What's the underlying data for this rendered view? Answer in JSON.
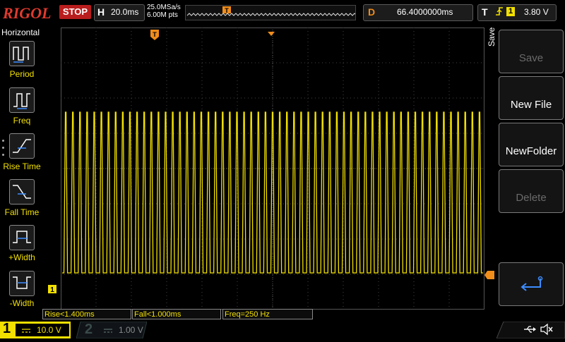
{
  "header": {
    "brand": "RIGOL",
    "run_state": "STOP",
    "timebase_label": "H",
    "timebase_value": "20.0ms",
    "sample_rate": "25.0MSa/s",
    "memory_depth": "6.00M pts",
    "delay_label": "D",
    "delay_value": "66.4000000ms",
    "trigger_label": "T",
    "trigger_source": "1",
    "trigger_level": "3.80 V",
    "trigger_position_marker": "T",
    "edge_icon": "rising-edge-icon"
  },
  "left_menu": {
    "title": "Horizontal",
    "items": [
      {
        "label": "Period",
        "icon": "period-icon"
      },
      {
        "label": "Freq",
        "icon": "freq-icon"
      },
      {
        "label": "Rise Time",
        "icon": "rise-time-icon"
      },
      {
        "label": "Fall Time",
        "icon": "fall-time-icon"
      },
      {
        "label": "+Width",
        "icon": "pos-width-icon"
      },
      {
        "label": "-Width",
        "icon": "neg-width-icon"
      }
    ]
  },
  "right_menu": {
    "title": "Save",
    "items": [
      {
        "label": "Save",
        "enabled": false
      },
      {
        "label": "New File",
        "enabled": true
      },
      {
        "label": "NewFolder",
        "enabled": true
      },
      {
        "label": "Delete",
        "enabled": false
      }
    ],
    "return_icon": "return-arrow-icon"
  },
  "waveform": {
    "channel_marker": "1",
    "color": "#f2e000",
    "cycles_on_screen": 59,
    "high_fraction": 0.3,
    "low_fraction": 0.87
  },
  "measurements": [
    "Rise<1.400ms",
    "Fall<1.000ms",
    "Freq=250 Hz"
  ],
  "channels": {
    "ch1_number": "1",
    "ch1_scale": "10.0 V",
    "ch2_number": "2",
    "ch2_scale": "1.00 V"
  },
  "colors": {
    "accent_orange": "#f08c1a",
    "ch1_yellow": "#f2e000",
    "stop_red": "#b91d1d"
  }
}
